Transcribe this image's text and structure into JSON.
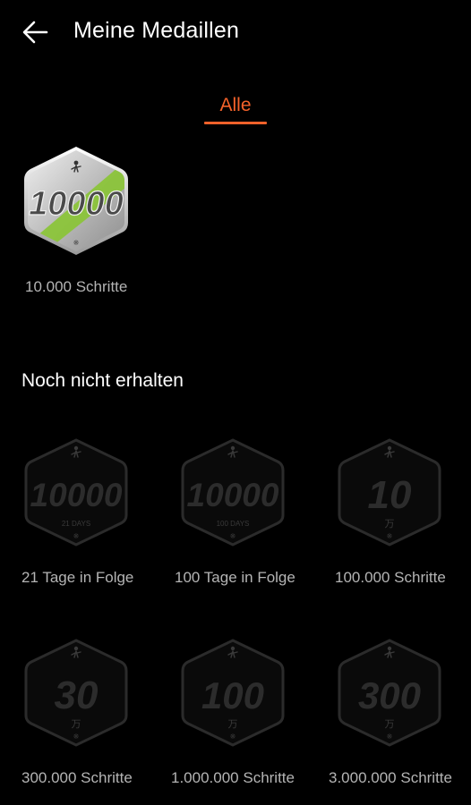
{
  "header": {
    "title": "Meine Medaillen",
    "back_icon": "arrow-left-icon"
  },
  "tabs": [
    {
      "label": "Alle",
      "active": true,
      "color": "#f4622a"
    }
  ],
  "earned": [
    {
      "label": "10.000 Schritte",
      "badge_number": "10000",
      "stripe_color": "#8bc43a"
    }
  ],
  "locked_section": {
    "title": "Noch nicht erhalten",
    "medals": [
      {
        "label": "21 Tage in Folge",
        "badge_number": "10000",
        "badge_sub": "21 DAYS"
      },
      {
        "label": "100 Tage in Folge",
        "badge_number": "10000",
        "badge_sub": "100 DAYS"
      },
      {
        "label": "100.000 Schritte",
        "badge_number": "10",
        "badge_sub": "万"
      },
      {
        "label": "300.000 Schritte",
        "badge_number": "30",
        "badge_sub": "万"
      },
      {
        "label": "1.000.000 Schritte",
        "badge_number": "100",
        "badge_sub": "万"
      },
      {
        "label": "3.000.000 Schritte",
        "badge_number": "300",
        "badge_sub": "万"
      }
    ]
  }
}
